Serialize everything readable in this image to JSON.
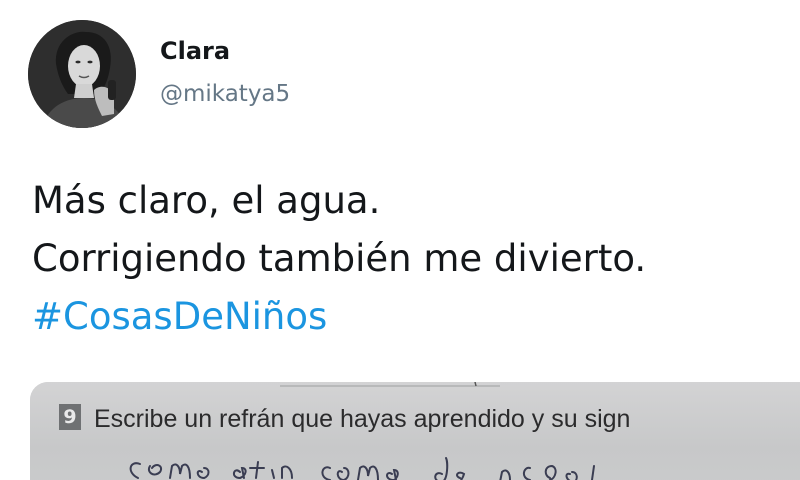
{
  "user": {
    "display_name": "Clara",
    "handle": "@mikatya5"
  },
  "tweet": {
    "lines": [
      "Más claro, el agua.",
      "Corrigiendo también me divierto."
    ],
    "hashtag": "#CosasDeNiños"
  },
  "attachment": {
    "exercise_number": "9",
    "exercise_prompt": "Escribe un refrán que hayas aprendido y su sign"
  },
  "colors": {
    "name": "#14171a",
    "handle": "#657786",
    "hashtag": "#1b95e0",
    "paper": "#c9cacb"
  }
}
